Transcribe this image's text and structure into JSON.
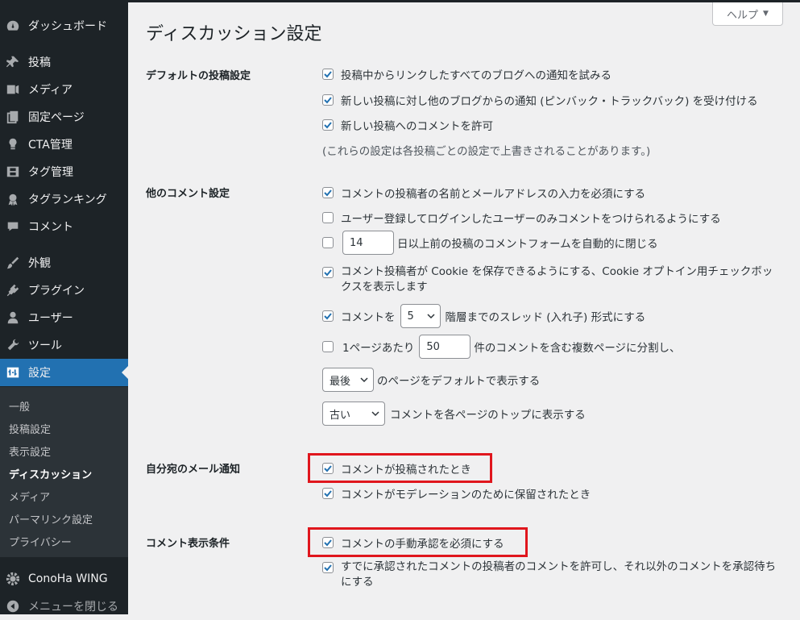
{
  "sidebar": {
    "items": [
      {
        "label": "ダッシュボード",
        "icon": "dashboard-icon"
      },
      {
        "label": "投稿",
        "icon": "pin-icon"
      },
      {
        "label": "メディア",
        "icon": "media-icon"
      },
      {
        "label": "固定ページ",
        "icon": "pages-icon"
      },
      {
        "label": "CTA管理",
        "icon": "lightbulb-icon"
      },
      {
        "label": "タグ管理",
        "icon": "film-icon"
      },
      {
        "label": "タグランキング",
        "icon": "award-icon"
      },
      {
        "label": "コメント",
        "icon": "comment-icon"
      },
      {
        "label": "外観",
        "icon": "brush-icon"
      },
      {
        "label": "プラグイン",
        "icon": "plugin-icon"
      },
      {
        "label": "ユーザー",
        "icon": "user-icon"
      },
      {
        "label": "ツール",
        "icon": "wrench-icon"
      },
      {
        "label": "設定",
        "icon": "settings-icon"
      },
      {
        "label": "ConoHa WING",
        "icon": "gear-icon"
      },
      {
        "label": "メニューを閉じる",
        "icon": "collapse-icon"
      }
    ],
    "submenu": [
      "一般",
      "投稿設定",
      "表示設定",
      "ディスカッション",
      "メディア",
      "パーマリンク設定",
      "プライバシー"
    ]
  },
  "help": {
    "label": "ヘルプ"
  },
  "page": {
    "title": "ディスカッション設定"
  },
  "sections": {
    "default_post": {
      "label": "デフォルトの投稿設定",
      "opt1": "投稿中からリンクしたすべてのブログへの通知を試みる",
      "opt2": "新しい投稿に対し他のブログからの通知 (ピンバック・トラックバック) を受け付ける",
      "opt3": "新しい投稿へのコメントを許可",
      "note": "(これらの設定は各投稿ごとの設定で上書きされることがあります。)"
    },
    "other": {
      "label": "他のコメント設定",
      "opt1": "コメントの投稿者の名前とメールアドレスの入力を必須にする",
      "opt2": "ユーザー登録してログインしたユーザーのみコメントをつけられるようにする",
      "close_days": "14",
      "close_text": "日以上前の投稿のコメントフォームを自動的に閉じる",
      "cookie_text": "コメント投稿者が Cookie を保存できるようにする、Cookie オプトイン用チェックボックスを表示します",
      "thread_pre": "コメントを",
      "thread_depth": "5",
      "thread_post": "階層までのスレッド (入れ子) 形式にする",
      "page_pre": "1ページあたり",
      "page_count": "50",
      "page_post": "件のコメントを含む複数ページに分割し、",
      "default_page": "最後",
      "default_page_post": "のページをデフォルトで表示する",
      "order": "古い",
      "order_post": "コメントを各ページのトップに表示する"
    },
    "email": {
      "label": "自分宛のメール通知",
      "opt1": "コメントが投稿されたとき",
      "opt2": "コメントがモデレーションのために保留されたとき"
    },
    "display": {
      "label": "コメント表示条件",
      "opt1": "コメントの手動承認を必須にする",
      "opt2": "すでに承認されたコメントの投稿者のコメントを許可し、それ以外のコメントを承認待ちにする"
    }
  },
  "colors": {
    "accent": "#2271b1",
    "highlight": "#e0161d",
    "sidebar": "#1d2327"
  }
}
